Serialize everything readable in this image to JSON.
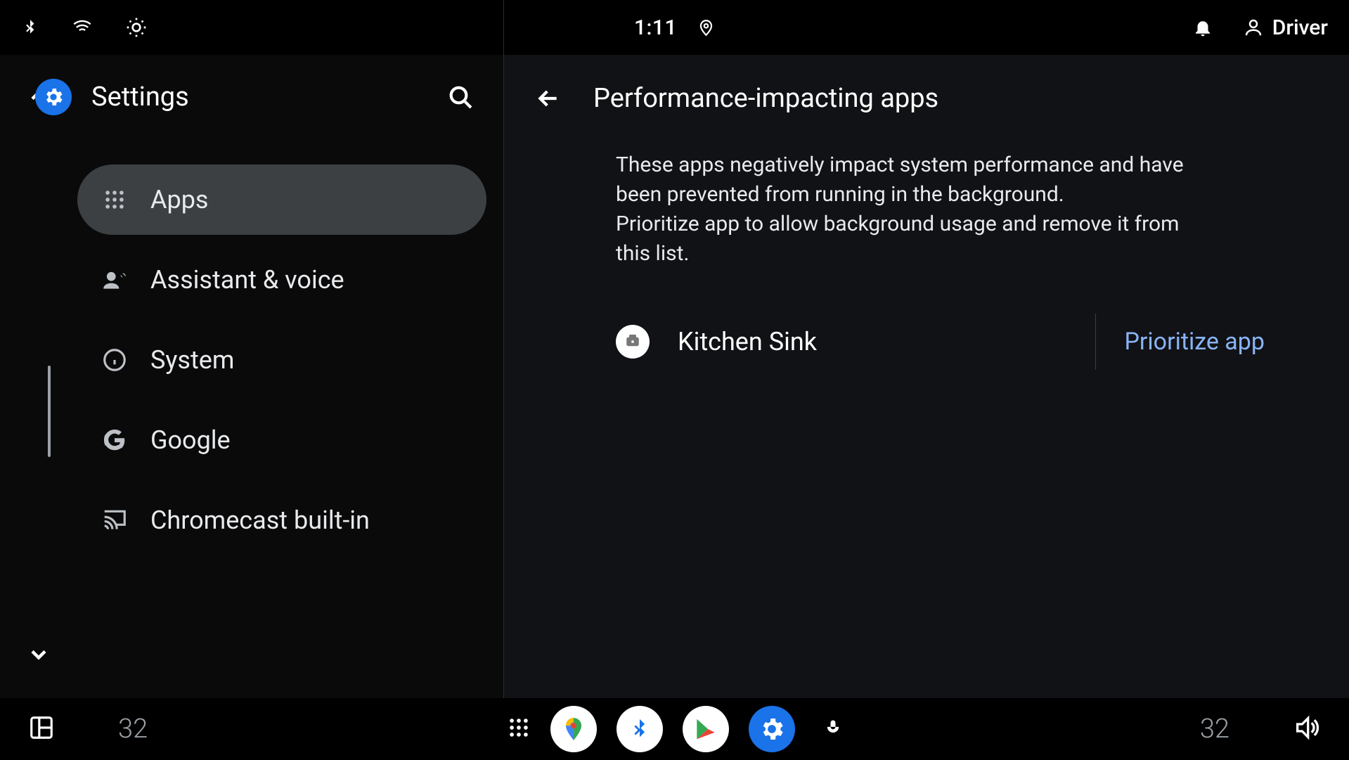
{
  "status": {
    "time": "1:11",
    "user": "Driver"
  },
  "sidebar": {
    "title": "Settings",
    "items": [
      {
        "label": "Apps",
        "selected": true,
        "icon": "grid"
      },
      {
        "label": "Assistant & voice",
        "selected": false,
        "icon": "assistant"
      },
      {
        "label": "System",
        "selected": false,
        "icon": "info"
      },
      {
        "label": "Google",
        "selected": false,
        "icon": "google"
      },
      {
        "label": "Chromecast built-in",
        "selected": false,
        "icon": "cast"
      }
    ]
  },
  "detail": {
    "title": "Performance-impacting apps",
    "description": "These apps negatively impact system performance and have been prevented from running in the background.\nPrioritize app to allow background usage and remove it from this list.",
    "apps": [
      {
        "name": "Kitchen Sink",
        "action": "Prioritize app"
      }
    ]
  },
  "bottombar": {
    "tempLeft": "32",
    "tempRight": "32"
  },
  "colors": {
    "accent": "#1a73e8",
    "link": "#8ab4f8"
  }
}
